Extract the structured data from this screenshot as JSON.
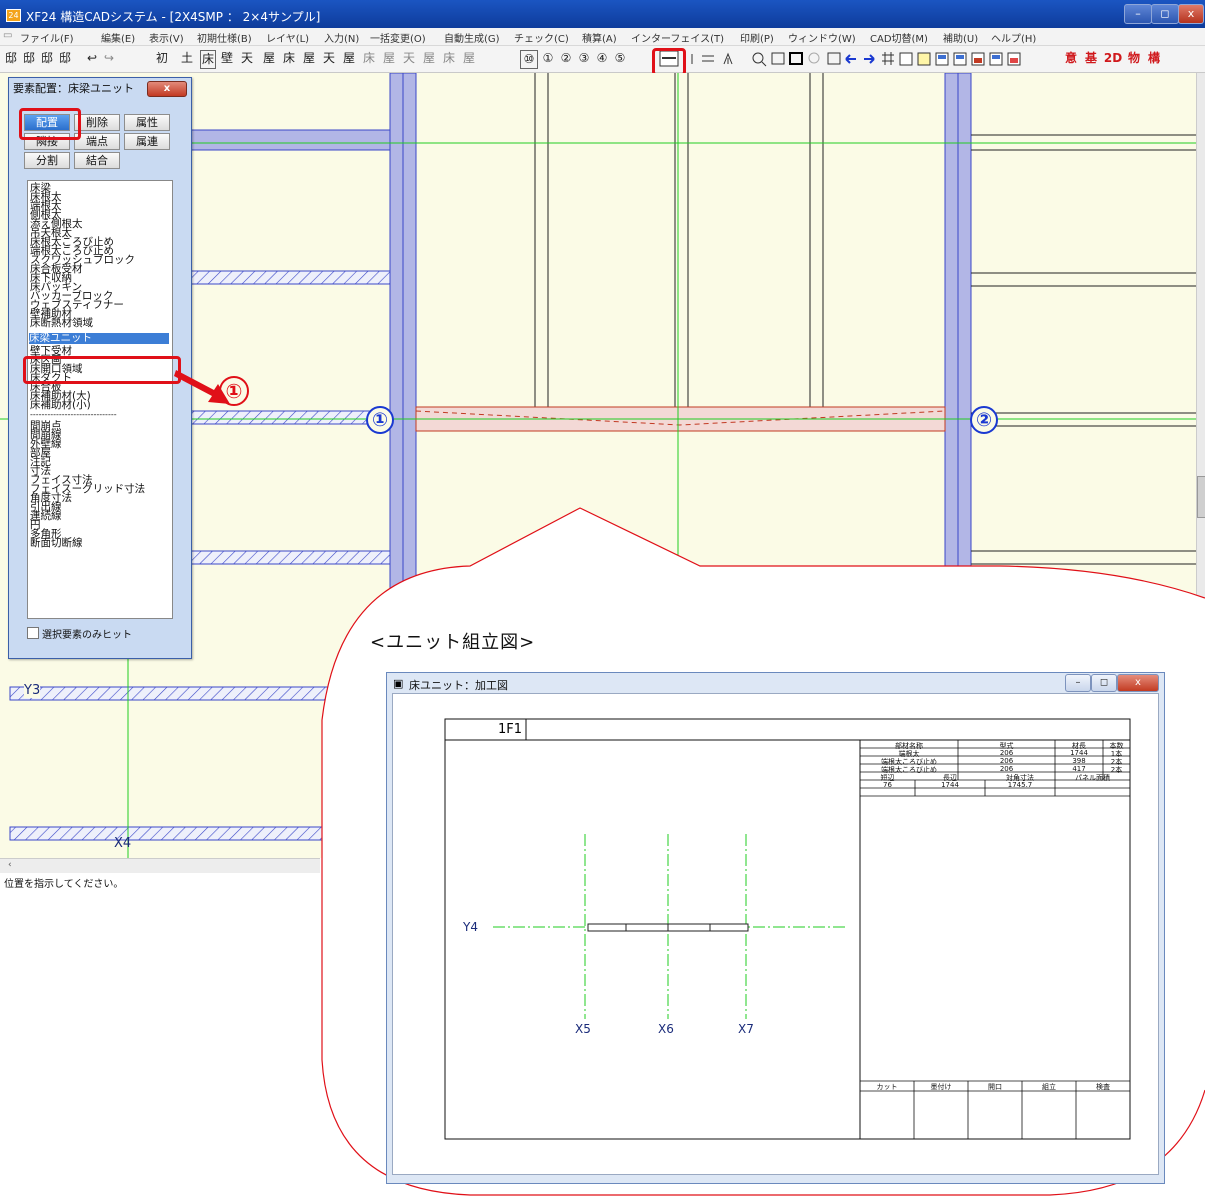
{
  "window": {
    "title": "XF24 構造CADシステム - [2X4SMP ： 2×4サンプル]",
    "app_icon": "24",
    "controls": {
      "minimize": "–",
      "restore": "◻",
      "close": "x"
    }
  },
  "menu": [
    "ファイル(F)",
    "編集(E)",
    "表示(V)",
    "初期仕様(B)",
    "レイヤ(L)",
    "入力(N)",
    "一括変更(O)",
    "自動生成(G)",
    "チェック(C)",
    "積算(A)",
    "インターフェイス(T)",
    "印刷(P)",
    "ウィンドウ(W)",
    "CAD切替(M)",
    "補助(U)",
    "ヘルプ(H)"
  ],
  "toolbar": {
    "left_icons": [
      "邸",
      "邸",
      "邸",
      "邸",
      "↩",
      "↪"
    ],
    "mode_glyphs": [
      "初",
      "土",
      "床",
      "壁",
      "天",
      "屋",
      "床",
      "屋",
      "天",
      "屋",
      "床",
      "屋",
      "天",
      "屋",
      "床",
      "屋"
    ],
    "circled_numbers": [
      "⑩",
      "①",
      "②",
      "③",
      "④",
      "⑤"
    ],
    "right_red_labels": [
      "意",
      "基",
      "2D",
      "物",
      "構"
    ]
  },
  "dialog": {
    "title": "要素配置：床梁ユニット",
    "close": "x",
    "buttons": [
      "配置",
      "削除",
      "属性",
      "隣接",
      "端点",
      "属連",
      "分割",
      "結合"
    ],
    "list_items": [
      "床梁",
      "床根太",
      "端根太",
      "側根太",
      "添え側根太",
      "吊天根太",
      "床根太ころび止め",
      "端根太ころび止め",
      "スクワッシュブロック",
      "床合板受材",
      "床下収納",
      "床パッキン",
      "バッカーブロック",
      "ウェブスティフナー",
      "壁補助材",
      "床断熱材領域",
      "床梁ユニット",
      "壁下受材",
      "床区画",
      "床開口領域",
      "床ダクト",
      "床合板",
      "床補助材(大)",
      "床補助材(小)",
      "------------------------------",
      "間崩点",
      "間崩線",
      "外壁線",
      "部屋",
      "注記",
      "寸法",
      "フェイス寸法",
      "フェイスーグリッド寸法",
      "角度寸法",
      "引出線",
      "連続線",
      "円",
      "多角形",
      "断面切断線"
    ],
    "selected_item": "床梁ユニット",
    "checkbox_label": "選択要素のみヒット"
  },
  "canvas": {
    "labels": {
      "y3": "Y3",
      "x4": "X4"
    }
  },
  "status_text": "位置を指示してください。",
  "annotations": {
    "callout_1": "①",
    "point_1": "①",
    "point_2": "②",
    "caption": "<ユニット組立図>"
  },
  "inset": {
    "title": "床ユニット：加工図",
    "floor_label": "1F1",
    "table_headers": [
      "部材名称",
      "型式",
      "材長",
      "本数"
    ],
    "table_rows": [
      [
        "端根太",
        "206",
        "1744",
        "1本"
      ],
      [
        "端根太ころび止め",
        "206",
        "398",
        "2本"
      ],
      [
        "端根太ころび止め",
        "206",
        "417",
        "2本"
      ]
    ],
    "dim_headers": [
      "短辺",
      "長辺",
      "対角寸法",
      "パネル面積"
    ],
    "dim_values": [
      "76",
      "1744",
      "1745.7",
      ""
    ],
    "footer_headers": [
      "カット",
      "墨付け",
      "開口",
      "組立",
      "検査"
    ],
    "axes": {
      "y4": "Y4",
      "x5": "X5",
      "x6": "X6",
      "x7": "X7"
    }
  },
  "colors": {
    "accent_red": "#e01018",
    "label_blue": "#1a39d1",
    "beam_fill": "#b2b6e6",
    "grid_green": "#22cc22"
  }
}
